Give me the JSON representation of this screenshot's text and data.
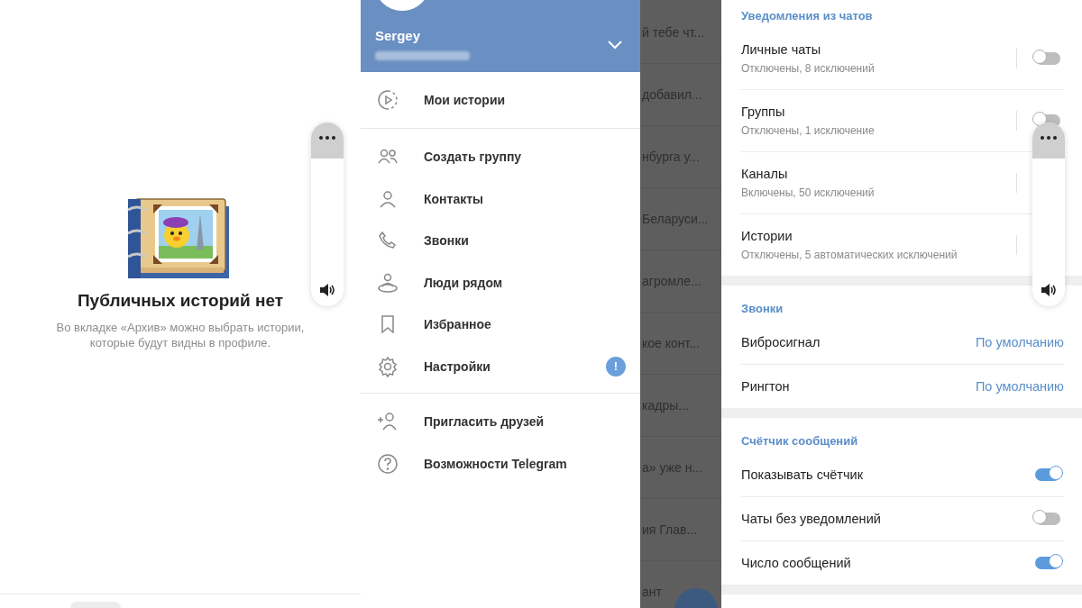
{
  "stories_panel": {
    "title": "Публичных историй нет",
    "description": "Во вкладке «Архив» можно выбрать истории, которые будут видны в профиле."
  },
  "drawer": {
    "user_name": "Sergey",
    "menu": [
      {
        "kind": "stories",
        "label": "Мои истории",
        "divider_after": true
      },
      {
        "kind": "group",
        "label": "Создать группу",
        "divider_after": false
      },
      {
        "kind": "person",
        "label": "Контакты",
        "divider_after": false
      },
      {
        "kind": "phone",
        "label": "Звонки",
        "divider_after": false
      },
      {
        "kind": "nearby",
        "label": "Люди рядом",
        "divider_after": false
      },
      {
        "kind": "bookmark",
        "label": "Избранное",
        "divider_after": false
      },
      {
        "kind": "gear",
        "label": "Настройки",
        "badge": "!",
        "divider_after": true
      },
      {
        "kind": "invite",
        "label": "Пригласить друзей",
        "divider_after": false
      },
      {
        "kind": "help",
        "label": "Возможности Telegram",
        "divider_after": false
      }
    ]
  },
  "chat_snippets": [
    "й тебе чт...",
    "добавил...",
    "нбурга у...",
    "Беларуси...",
    "агромле...",
    "кое конт...",
    "кадры...",
    "а» уже н...",
    "ия Глав...",
    "ант"
  ],
  "notification_settings": {
    "sections": [
      {
        "title": "Уведомления из чатов",
        "rows": [
          {
            "kind": "switch",
            "title": "Личные чаты",
            "subtitle": "Отключены, 8 исключений",
            "on": false
          },
          {
            "kind": "switch",
            "title": "Группы",
            "subtitle": "Отключены, 1 исключение",
            "on": false
          },
          {
            "kind": "switch",
            "title": "Каналы",
            "subtitle": "Включены, 50 исключений"
          },
          {
            "kind": "switch",
            "title": "Истории",
            "subtitle": "Отключены, 5 автоматических исключений"
          }
        ]
      },
      {
        "title": "Звонки",
        "rows": [
          {
            "kind": "value",
            "title": "Вибросигнал",
            "value": "По умолчанию"
          },
          {
            "kind": "value",
            "title": "Рингтон",
            "value": "По умолчанию"
          }
        ]
      },
      {
        "title": "Счётчик сообщений",
        "rows": [
          {
            "kind": "switch",
            "title": "Показывать счётчик",
            "on": true
          },
          {
            "kind": "switch",
            "title": "Чаты без уведомлений",
            "on": false
          },
          {
            "kind": "switch",
            "title": "Число сообщений",
            "on": true
          }
        ]
      }
    ]
  }
}
